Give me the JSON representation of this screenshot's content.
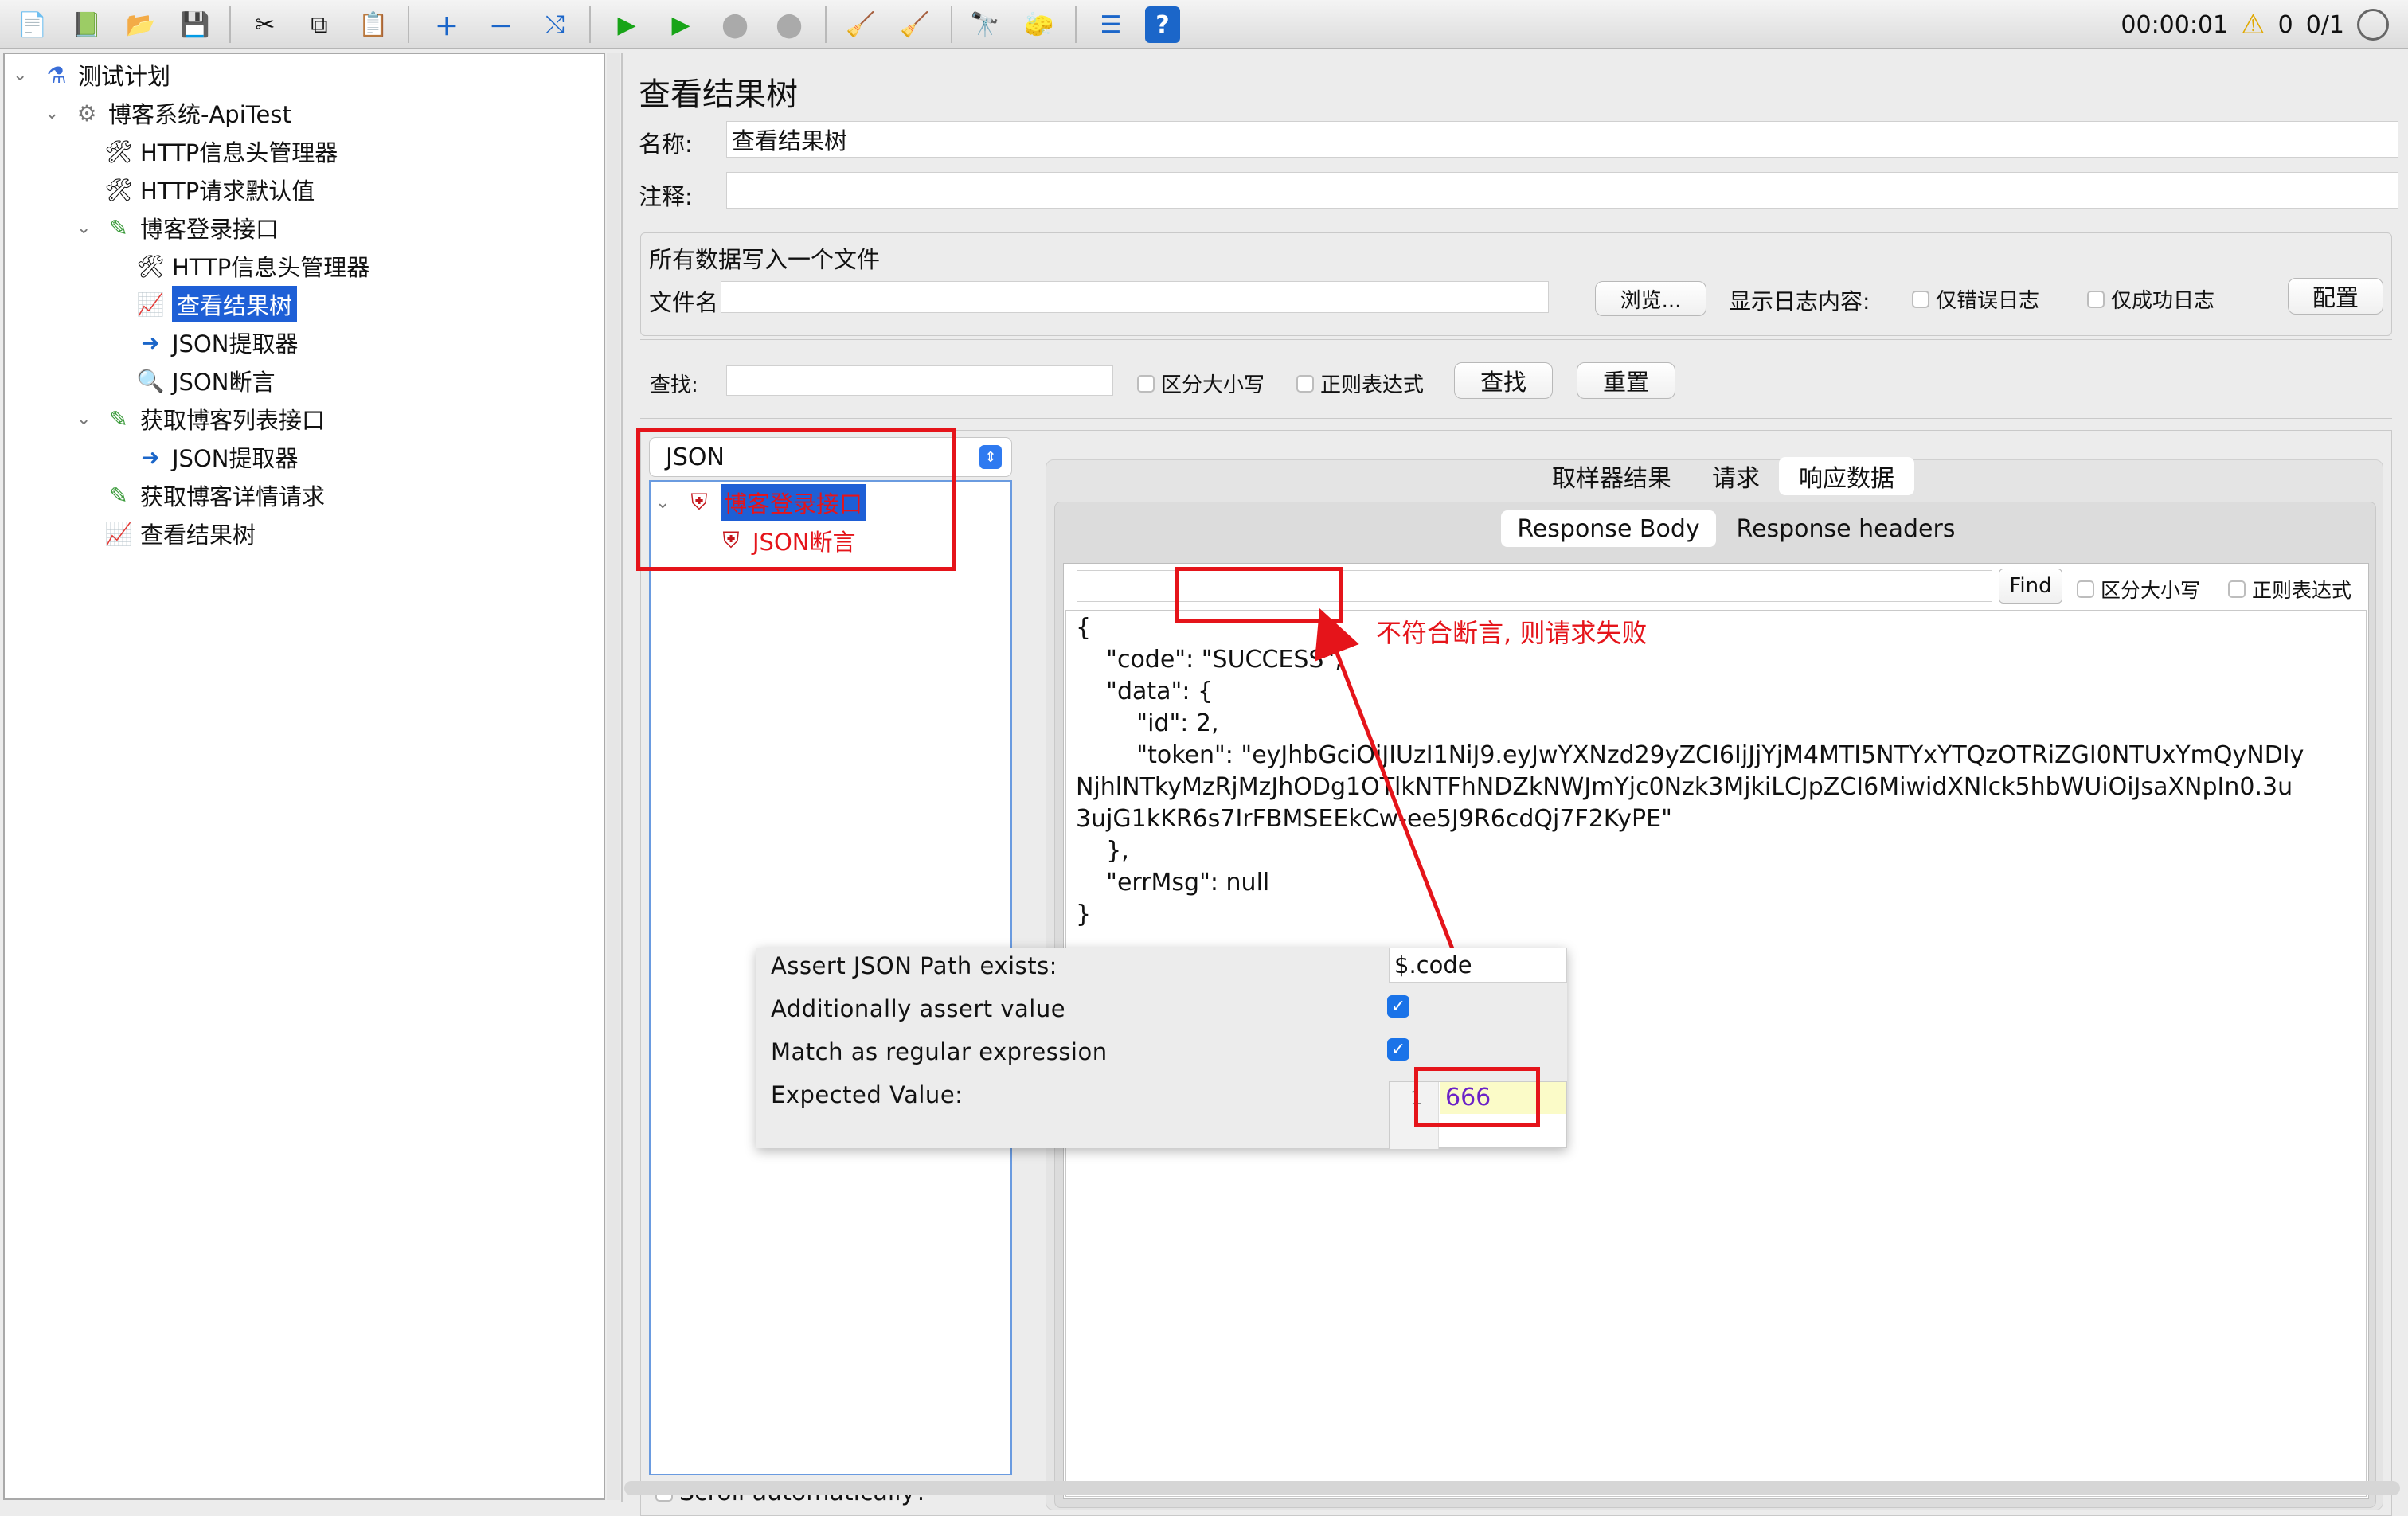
{
  "toolbar": {
    "icons": [
      "new-icon",
      "templates-icon",
      "open-icon",
      "save-icon",
      "cut-icon",
      "copy-icon",
      "paste-icon",
      "expand-icon",
      "collapse-icon",
      "toggle-icon",
      "start-icon",
      "start-no-pause-icon",
      "stop-icon",
      "shutdown-icon",
      "clear-icon",
      "clear-all-icon",
      "search-icon",
      "reset-search-icon",
      "function-helper-icon",
      "help-icon"
    ],
    "timer": "00:00:01",
    "warning_count": "0",
    "threads": "0/1"
  },
  "tree": {
    "root": "测试计划",
    "items": [
      {
        "label": "博客系统-ApiTest",
        "icon": "gear-icon"
      },
      {
        "label": "HTTP信息头管理器",
        "icon": "wrench-icon"
      },
      {
        "label": "HTTP请求默认值",
        "icon": "wrench-icon"
      },
      {
        "label": "博客登录接口",
        "icon": "pipette-icon"
      },
      {
        "label": "HTTP信息头管理器",
        "icon": "wrench-icon"
      },
      {
        "label": "查看结果树",
        "icon": "graph-icon"
      },
      {
        "label": "JSON提取器",
        "icon": "extractor-icon"
      },
      {
        "label": "JSON断言",
        "icon": "magnifier-icon"
      },
      {
        "label": "获取博客列表接口",
        "icon": "pipette-icon"
      },
      {
        "label": "JSON提取器",
        "icon": "extractor-icon"
      },
      {
        "label": "获取博客详情请求",
        "icon": "pipette-icon"
      },
      {
        "label": "查看结果树",
        "icon": "graph-icon"
      }
    ]
  },
  "panel": {
    "title": "查看结果树",
    "name_label": "名称:",
    "name_value": "查看结果树",
    "comment_label": "注释:",
    "file_section": "所有数据写入一个文件",
    "file_label": "文件名",
    "browse": "浏览...",
    "log_display": "显示日志内容:",
    "errors_only": "仅错误日志",
    "success_only": "仅成功日志",
    "configure": "配置",
    "search_label": "查找:",
    "case_sensitive": "区分大小写",
    "regex": "正则表达式",
    "find_btn": "查找",
    "reset_btn": "重置"
  },
  "results": {
    "renderer": "JSON",
    "samples": [
      {
        "label": "博客登录接口",
        "status": "error"
      },
      {
        "label": "JSON断言",
        "status": "error"
      }
    ],
    "scroll_auto": "Scroll automatically?",
    "tabs": [
      "取样器结果",
      "请求",
      "响应数据"
    ],
    "subtabs": [
      "Response Body",
      "Response headers"
    ],
    "find_btn": "Find",
    "case_sensitive": "区分大小写",
    "regex": "正则表达式",
    "body_lines": [
      "{",
      "    \"code\": \"SUCCESS\",",
      "    \"data\": {",
      "        \"id\": 2,",
      "        \"token\": \"eyJhbGciOiJIUzI1NiJ9.eyJwYXNzd29yZCI6IjJjYjM4MTI5NTYxYTQzOTRiZGI0NTUxYmQyNDIy",
      "NjhlNTkyMzRjMzJhODg1OTlkNTFhNDZkNWJmYjc0Nzk3MjkiLCJpZCI6MiwidXNlck5hbWUiOiJsaXNpIn0.3u",
      "3ujG1kKR6s7IrFBMSEEkCw-ee5J9R6cdQj7F2KyPE\"",
      "    },",
      "    \"errMsg\": null",
      "}"
    ],
    "annotation": "不符合断言, 则请求失败"
  },
  "assertion": {
    "path_label": "Assert JSON Path exists:",
    "path_value": "$.code",
    "assert_value_label": "Additionally assert value",
    "regex_label": "Match as regular expression",
    "expected_label": "Expected Value:",
    "line_no": "1",
    "expected_value": "666"
  },
  "colors": {
    "accent": "#1e5fd6",
    "annotation_red": "#e5141a",
    "error_text": "#e5141a"
  }
}
